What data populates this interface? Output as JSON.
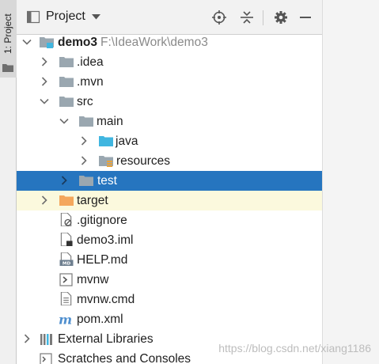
{
  "tool_strip": {
    "label": "1: Project",
    "icon": "folder-icon"
  },
  "header": {
    "title": "Project",
    "icons": [
      "project-view-icon",
      "chevron-down-icon",
      "locate-icon",
      "collapse-all-icon",
      "gear-icon",
      "minimize-icon"
    ]
  },
  "tree": [
    {
      "label": "demo3",
      "path": "F:\\IdeaWork\\demo3",
      "icon": "module-folder-icon",
      "arrow": "expanded"
    },
    {
      "label": ".idea",
      "icon": "folder-icon",
      "arrow": "collapsed"
    },
    {
      "label": ".mvn",
      "icon": "folder-icon",
      "arrow": "collapsed"
    },
    {
      "label": "src",
      "icon": "folder-icon",
      "arrow": "expanded"
    },
    {
      "label": "main",
      "icon": "folder-icon",
      "arrow": "expanded"
    },
    {
      "label": "java",
      "icon": "source-folder-icon",
      "arrow": "collapsed"
    },
    {
      "label": "resources",
      "icon": "resources-folder-icon",
      "arrow": "collapsed"
    },
    {
      "label": "test",
      "icon": "folder-icon",
      "arrow": "collapsed",
      "state": "selected"
    },
    {
      "label": "target",
      "icon": "excluded-folder-icon",
      "arrow": "collapsed",
      "state": "excluded"
    },
    {
      "label": ".gitignore",
      "icon": "ignored-file-icon"
    },
    {
      "label": "demo3.iml",
      "icon": "iml-file-icon"
    },
    {
      "label": "HELP.md",
      "icon": "markdown-file-icon"
    },
    {
      "label": "mvnw",
      "icon": "shell-script-icon"
    },
    {
      "label": "mvnw.cmd",
      "icon": "text-file-icon"
    },
    {
      "label": "pom.xml",
      "icon": "maven-icon"
    },
    {
      "label": "External Libraries",
      "icon": "libraries-icon",
      "arrow": "collapsed"
    },
    {
      "label": "Scratches and Consoles",
      "icon": "scratches-icon",
      "arrow": "none"
    }
  ],
  "colors": {
    "selection": "#2675bf",
    "excluded_row": "#fbf9dd",
    "folder": "#9aa7b0",
    "source_folder": "#40b6e0",
    "excluded_folder": "#f4a75c"
  },
  "watermark": "https://blog.csdn.net/xiang1186"
}
